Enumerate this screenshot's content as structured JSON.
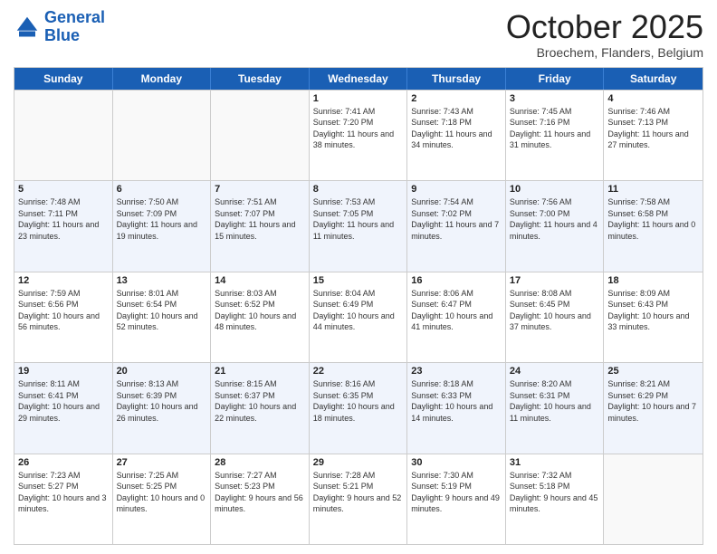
{
  "header": {
    "logo_line1": "General",
    "logo_line2": "Blue",
    "month": "October 2025",
    "location": "Broechem, Flanders, Belgium"
  },
  "weekdays": [
    "Sunday",
    "Monday",
    "Tuesday",
    "Wednesday",
    "Thursday",
    "Friday",
    "Saturday"
  ],
  "weeks": [
    [
      {
        "day": "",
        "info": ""
      },
      {
        "day": "",
        "info": ""
      },
      {
        "day": "",
        "info": ""
      },
      {
        "day": "1",
        "info": "Sunrise: 7:41 AM\nSunset: 7:20 PM\nDaylight: 11 hours\nand 38 minutes."
      },
      {
        "day": "2",
        "info": "Sunrise: 7:43 AM\nSunset: 7:18 PM\nDaylight: 11 hours\nand 34 minutes."
      },
      {
        "day": "3",
        "info": "Sunrise: 7:45 AM\nSunset: 7:16 PM\nDaylight: 11 hours\nand 31 minutes."
      },
      {
        "day": "4",
        "info": "Sunrise: 7:46 AM\nSunset: 7:13 PM\nDaylight: 11 hours\nand 27 minutes."
      }
    ],
    [
      {
        "day": "5",
        "info": "Sunrise: 7:48 AM\nSunset: 7:11 PM\nDaylight: 11 hours\nand 23 minutes."
      },
      {
        "day": "6",
        "info": "Sunrise: 7:50 AM\nSunset: 7:09 PM\nDaylight: 11 hours\nand 19 minutes."
      },
      {
        "day": "7",
        "info": "Sunrise: 7:51 AM\nSunset: 7:07 PM\nDaylight: 11 hours\nand 15 minutes."
      },
      {
        "day": "8",
        "info": "Sunrise: 7:53 AM\nSunset: 7:05 PM\nDaylight: 11 hours\nand 11 minutes."
      },
      {
        "day": "9",
        "info": "Sunrise: 7:54 AM\nSunset: 7:02 PM\nDaylight: 11 hours\nand 7 minutes."
      },
      {
        "day": "10",
        "info": "Sunrise: 7:56 AM\nSunset: 7:00 PM\nDaylight: 11 hours\nand 4 minutes."
      },
      {
        "day": "11",
        "info": "Sunrise: 7:58 AM\nSunset: 6:58 PM\nDaylight: 11 hours\nand 0 minutes."
      }
    ],
    [
      {
        "day": "12",
        "info": "Sunrise: 7:59 AM\nSunset: 6:56 PM\nDaylight: 10 hours\nand 56 minutes."
      },
      {
        "day": "13",
        "info": "Sunrise: 8:01 AM\nSunset: 6:54 PM\nDaylight: 10 hours\nand 52 minutes."
      },
      {
        "day": "14",
        "info": "Sunrise: 8:03 AM\nSunset: 6:52 PM\nDaylight: 10 hours\nand 48 minutes."
      },
      {
        "day": "15",
        "info": "Sunrise: 8:04 AM\nSunset: 6:49 PM\nDaylight: 10 hours\nand 44 minutes."
      },
      {
        "day": "16",
        "info": "Sunrise: 8:06 AM\nSunset: 6:47 PM\nDaylight: 10 hours\nand 41 minutes."
      },
      {
        "day": "17",
        "info": "Sunrise: 8:08 AM\nSunset: 6:45 PM\nDaylight: 10 hours\nand 37 minutes."
      },
      {
        "day": "18",
        "info": "Sunrise: 8:09 AM\nSunset: 6:43 PM\nDaylight: 10 hours\nand 33 minutes."
      }
    ],
    [
      {
        "day": "19",
        "info": "Sunrise: 8:11 AM\nSunset: 6:41 PM\nDaylight: 10 hours\nand 29 minutes."
      },
      {
        "day": "20",
        "info": "Sunrise: 8:13 AM\nSunset: 6:39 PM\nDaylight: 10 hours\nand 26 minutes."
      },
      {
        "day": "21",
        "info": "Sunrise: 8:15 AM\nSunset: 6:37 PM\nDaylight: 10 hours\nand 22 minutes."
      },
      {
        "day": "22",
        "info": "Sunrise: 8:16 AM\nSunset: 6:35 PM\nDaylight: 10 hours\nand 18 minutes."
      },
      {
        "day": "23",
        "info": "Sunrise: 8:18 AM\nSunset: 6:33 PM\nDaylight: 10 hours\nand 14 minutes."
      },
      {
        "day": "24",
        "info": "Sunrise: 8:20 AM\nSunset: 6:31 PM\nDaylight: 10 hours\nand 11 minutes."
      },
      {
        "day": "25",
        "info": "Sunrise: 8:21 AM\nSunset: 6:29 PM\nDaylight: 10 hours\nand 7 minutes."
      }
    ],
    [
      {
        "day": "26",
        "info": "Sunrise: 7:23 AM\nSunset: 5:27 PM\nDaylight: 10 hours\nand 3 minutes."
      },
      {
        "day": "27",
        "info": "Sunrise: 7:25 AM\nSunset: 5:25 PM\nDaylight: 10 hours\nand 0 minutes."
      },
      {
        "day": "28",
        "info": "Sunrise: 7:27 AM\nSunset: 5:23 PM\nDaylight: 9 hours\nand 56 minutes."
      },
      {
        "day": "29",
        "info": "Sunrise: 7:28 AM\nSunset: 5:21 PM\nDaylight: 9 hours\nand 52 minutes."
      },
      {
        "day": "30",
        "info": "Sunrise: 7:30 AM\nSunset: 5:19 PM\nDaylight: 9 hours\nand 49 minutes."
      },
      {
        "day": "31",
        "info": "Sunrise: 7:32 AM\nSunset: 5:18 PM\nDaylight: 9 hours\nand 45 minutes."
      },
      {
        "day": "",
        "info": ""
      }
    ]
  ]
}
